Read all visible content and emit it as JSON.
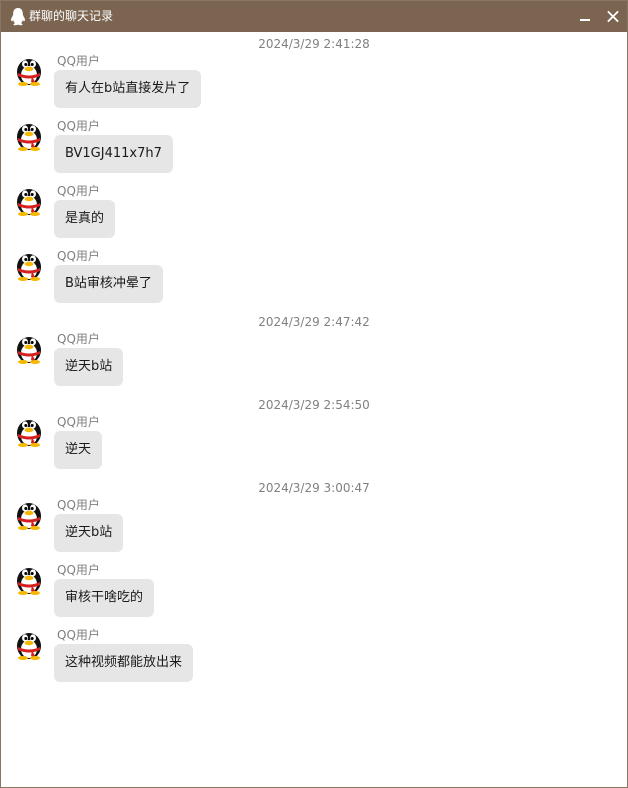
{
  "window": {
    "title": "群聊的聊天记录"
  },
  "colors": {
    "titlebar": "#7b6450",
    "bubble": "#e6e6e6",
    "timestamp_text": "#808080",
    "sender_text": "#808080",
    "message_text": "#1a1a1a"
  },
  "icons": {
    "title": "qq-penguin-icon",
    "minimize": "minimize-icon",
    "close": "close-icon",
    "avatar": "qq-penguin-avatar"
  },
  "timestamps": [
    "2024/3/29 2:41:28",
    "2024/3/29 2:47:42",
    "2024/3/29 2:54:50",
    "2024/3/29 3:00:47"
  ],
  "messages": [
    {
      "sender": "QQ用户",
      "text": "有人在b站直接发片了"
    },
    {
      "sender": "QQ用户",
      "text": "BV1GJ411x7h7"
    },
    {
      "sender": "QQ用户",
      "text": "是真的"
    },
    {
      "sender": "QQ用户",
      "text": "B站审核冲晕了"
    },
    {
      "sender": "QQ用户",
      "text": "逆天b站"
    },
    {
      "sender": "QQ用户",
      "text": "逆天"
    },
    {
      "sender": "QQ用户",
      "text": "逆天b站"
    },
    {
      "sender": "QQ用户",
      "text": "审核干啥吃的"
    },
    {
      "sender": "QQ用户",
      "text": "这种视频都能放出来"
    }
  ]
}
